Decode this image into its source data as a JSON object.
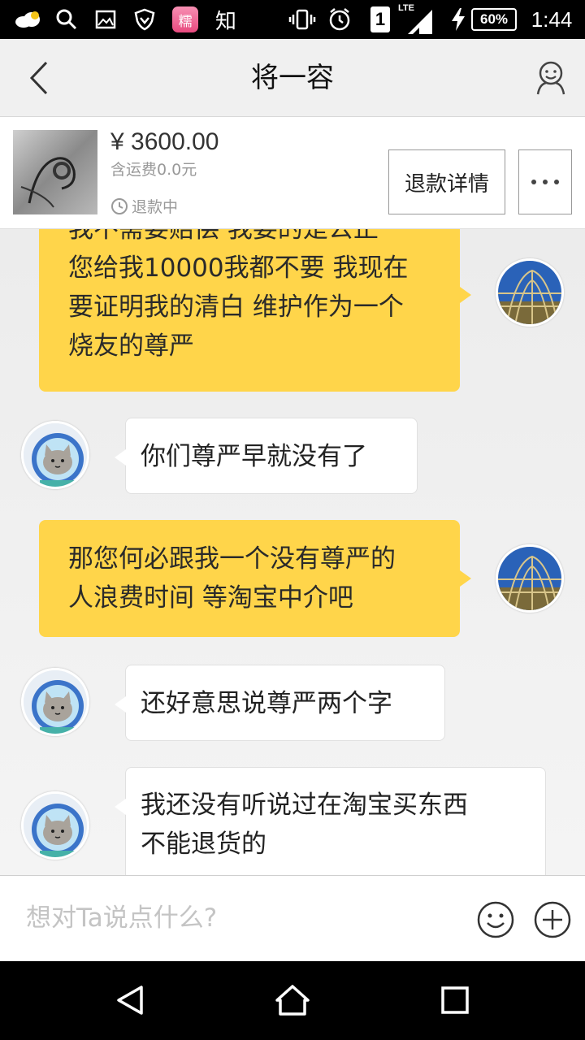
{
  "status_bar": {
    "app_badge": "糯",
    "zhihu": "知",
    "sim_slot": "1",
    "network": "LTE",
    "battery": "60%",
    "time": "1:44"
  },
  "header": {
    "title": "将一容"
  },
  "product": {
    "price": "¥ 3600.00",
    "shipping": "含运费0.0元",
    "status": "退款中",
    "refund_button": "退款详情"
  },
  "chat": {
    "messages": [
      {
        "side": "self",
        "lines": [
          "我不需要赔偿 我要的是公正",
          "您给我10000我都不要 我现在",
          "要证明我的清白 维护作为一个",
          "烧友的尊严"
        ]
      },
      {
        "side": "peer",
        "lines": [
          "你们尊严早就没有了"
        ]
      },
      {
        "side": "self",
        "lines": [
          "那您何必跟我一个没有尊严的",
          "人浪费时间 等淘宝中介吧"
        ]
      },
      {
        "side": "peer",
        "lines": [
          "还好意思说尊严两个字"
        ]
      },
      {
        "side": "peer",
        "lines": [
          "我还没有听说过在淘宝买东西",
          "不能退货的"
        ]
      }
    ]
  },
  "input": {
    "placeholder": "想对Ta说点什么?"
  },
  "colors": {
    "self_bubble": "#ffd54a",
    "peer_bubble": "#ffffff",
    "background": "#efefef"
  },
  "icons": [
    "back-chevron-icon",
    "profile-icon",
    "clock-icon",
    "more-icon",
    "emoji-icon",
    "plus-icon",
    "nav-back-icon",
    "nav-home-icon",
    "nav-recent-icon"
  ]
}
